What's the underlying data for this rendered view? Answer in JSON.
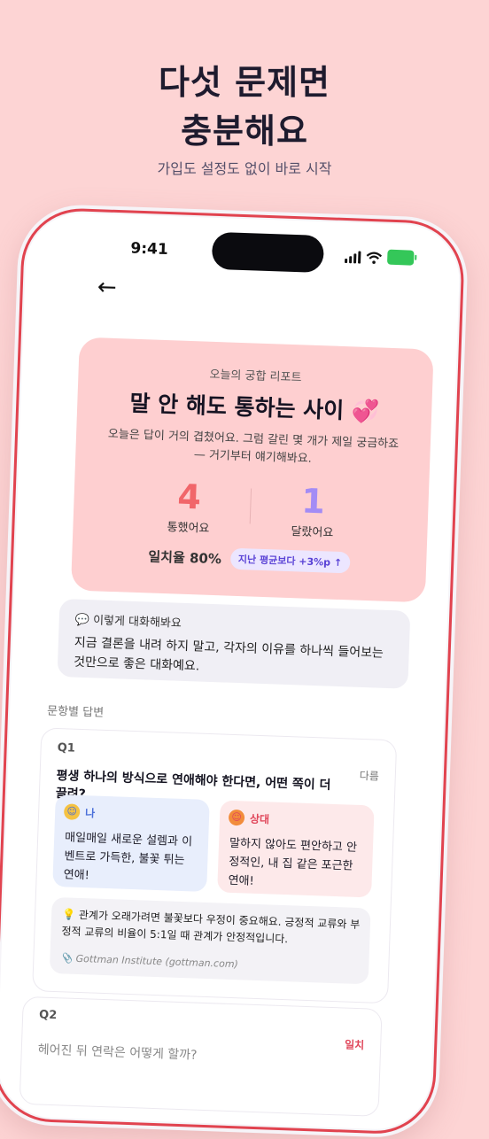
{
  "headline": {
    "line1": "다섯 문제면",
    "line2": "충분해요"
  },
  "subtitle": "가입도 설정도 없이 바로 시작",
  "status_bar": {
    "time": "9:41"
  },
  "report": {
    "kicker": "오늘의 궁합 리포트",
    "title": "말 안 해도 통하는 사이 💞",
    "description": "오늘은 답이 거의 겹쳤어요. 그럼 갈린 몇 개가 제일 궁금하죠 — 거기부터 얘기해봐요.",
    "matched": {
      "value": "4",
      "label": "통했어요",
      "color": "#f1666a"
    },
    "differed": {
      "value": "1",
      "label": "달랐어요",
      "color": "#a38cf5"
    },
    "match_rate": "일치율 80%",
    "delta_badge": "지난 평균보다 +3%p ↑"
  },
  "tip": {
    "header": "💬 이렇게 대화해봐요",
    "body": "지금 결론을 내려 하지 말고, 각자의 이유를 하나씩 들어보는 것만으로 좋은 대화예요."
  },
  "answers_section_label": "문항별 답변",
  "questions": [
    {
      "number": "Q1",
      "tag": "다름",
      "text": "평생 하나의 방식으로 연애해야 한다면, 어떤 쪽이 더 끌려?",
      "me": {
        "label": "나",
        "answer": "매일매일 새로운 설렘과 이벤트로 가득한, 불꽃 튀는 연애!"
      },
      "partner": {
        "label": "상대",
        "answer": "말하지 않아도 편안하고 안정적인, 내 집 같은 포근한 연애!"
      },
      "fact": "💡 관계가 오래가려면 불꽃보다 우정이 중요해요. 긍정적 교류와 부정적 교류의 비율이 5:1일 때 관계가 안정적입니다.",
      "source": "📎 Gottman Institute (gottman.com)"
    },
    {
      "number": "Q2",
      "tag": "일치",
      "text": "헤어진 뒤 연락은 어떻게 할까?"
    }
  ]
}
